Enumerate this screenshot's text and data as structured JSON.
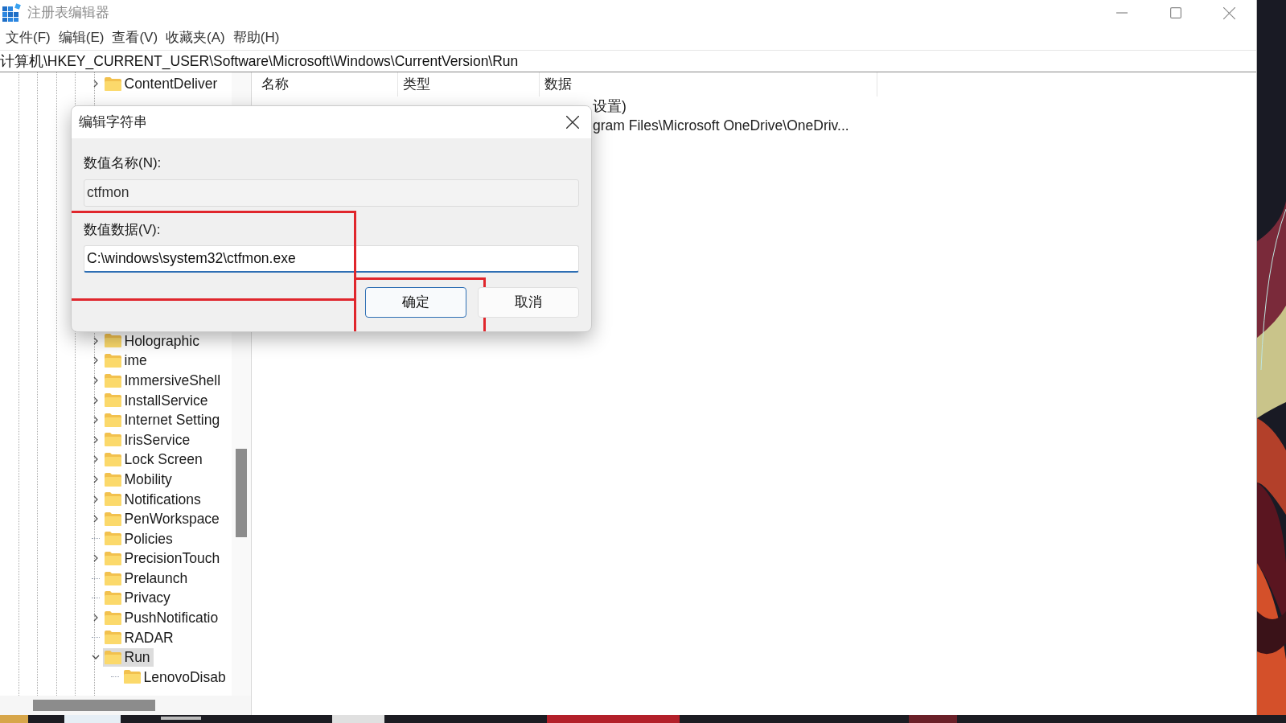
{
  "window": {
    "title": "注册表编辑器"
  },
  "menu": [
    "文件(F)",
    "编辑(E)",
    "查看(V)",
    "收藏夹(A)",
    "帮助(H)"
  ],
  "address": "计算机\\HKEY_CURRENT_USER\\Software\\Microsoft\\Windows\\CurrentVersion\\Run",
  "tree_top": [
    {
      "label": "ContentDeliver",
      "expandable": true,
      "expanded": false,
      "selected": false
    }
  ],
  "tree": [
    {
      "label": "Holographic",
      "expandable": true,
      "expanded": false,
      "selected": false
    },
    {
      "label": "ime",
      "expandable": true,
      "expanded": false,
      "selected": false
    },
    {
      "label": "ImmersiveShell",
      "expandable": true,
      "expanded": false,
      "selected": false
    },
    {
      "label": "InstallService",
      "expandable": true,
      "expanded": false,
      "selected": false
    },
    {
      "label": "Internet Setting",
      "expandable": true,
      "expanded": false,
      "selected": false
    },
    {
      "label": "IrisService",
      "expandable": true,
      "expanded": false,
      "selected": false
    },
    {
      "label": "Lock Screen",
      "expandable": true,
      "expanded": false,
      "selected": false
    },
    {
      "label": "Mobility",
      "expandable": true,
      "expanded": false,
      "selected": false
    },
    {
      "label": "Notifications",
      "expandable": true,
      "expanded": false,
      "selected": false
    },
    {
      "label": "PenWorkspace",
      "expandable": true,
      "expanded": false,
      "selected": false
    },
    {
      "label": "Policies",
      "expandable": false,
      "selected": false
    },
    {
      "label": "PrecisionTouch",
      "expandable": true,
      "expanded": false,
      "selected": false
    },
    {
      "label": "Prelaunch",
      "expandable": false,
      "selected": false
    },
    {
      "label": "Privacy",
      "expandable": false,
      "selected": false
    },
    {
      "label": "PushNotificatio",
      "expandable": true,
      "expanded": false,
      "selected": false
    },
    {
      "label": "RADAR",
      "expandable": false,
      "selected": false
    },
    {
      "label": "Run",
      "expandable": true,
      "expanded": true,
      "selected": true,
      "children": [
        {
          "label": "LenovoDisab",
          "expandable": false,
          "selected": false
        }
      ]
    }
  ],
  "list": {
    "columns": [
      "名称",
      "类型",
      "数据"
    ],
    "rows": [
      {
        "data": "设置)"
      },
      {
        "data": "gram Files\\Microsoft OneDrive\\OneDriv..."
      }
    ]
  },
  "dialog": {
    "title": "编辑字符串",
    "name_label": "数值名称(N):",
    "name_value": "ctfmon",
    "data_label": "数值数据(V):",
    "data_value": "C:\\windows\\system32\\ctfmon.exe",
    "data_highlighted": true,
    "buttons": [
      {
        "label": "确定",
        "default": true,
        "highlighted": true
      },
      {
        "label": "取消",
        "default": false,
        "highlighted": false
      }
    ]
  }
}
